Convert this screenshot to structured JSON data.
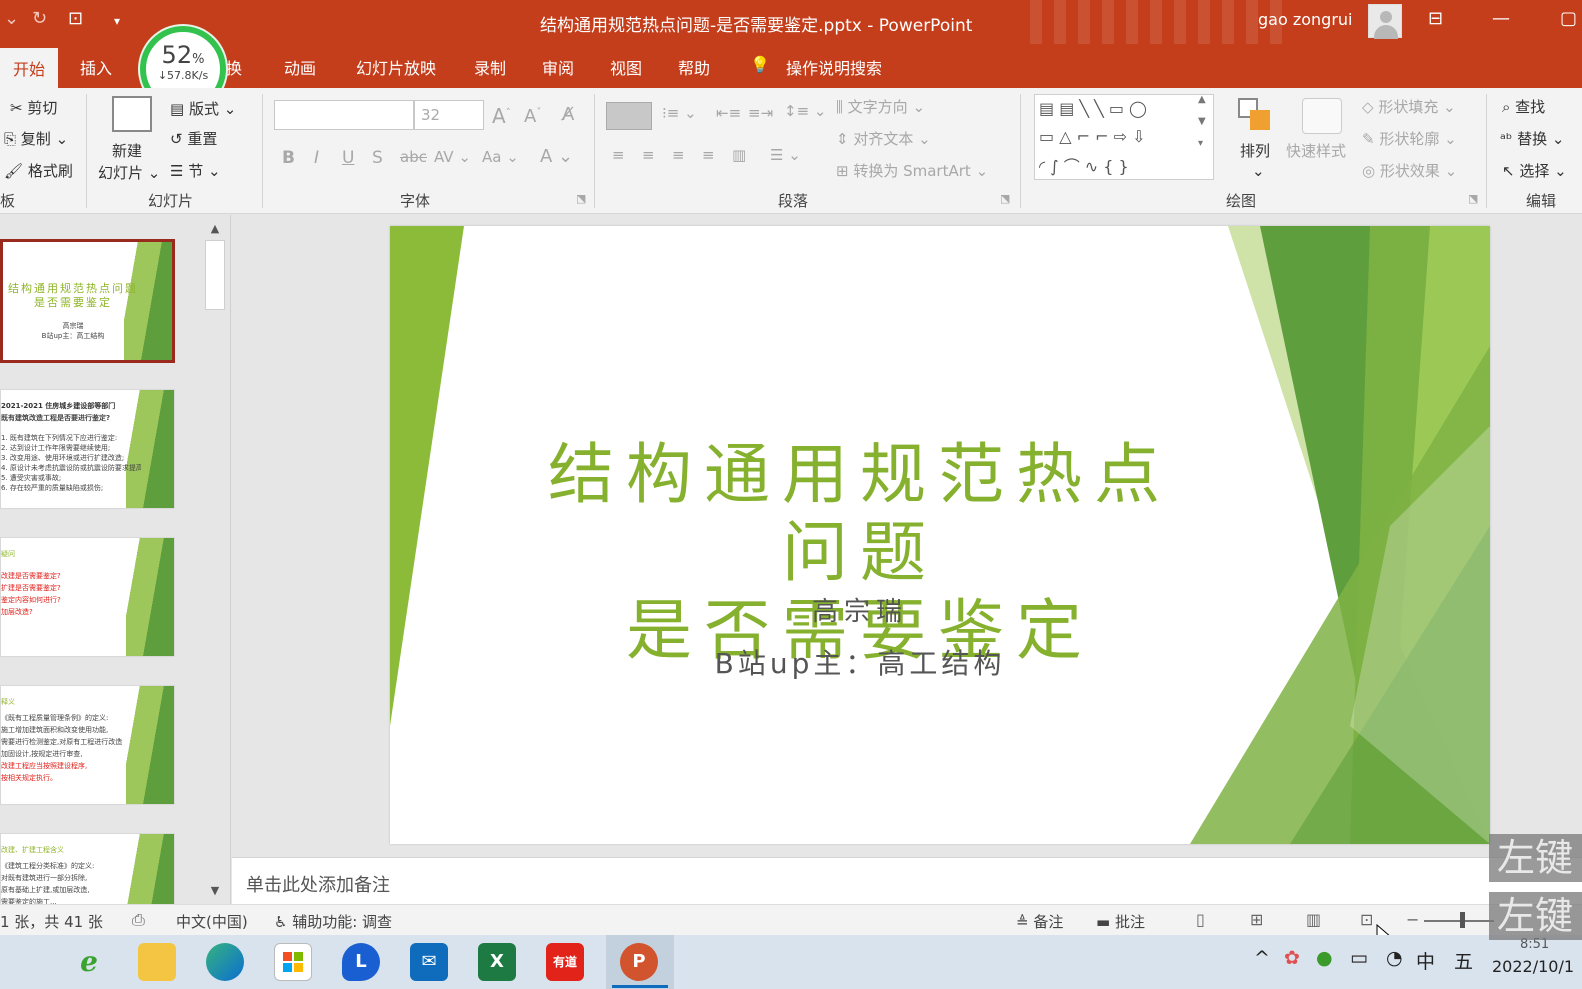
{
  "window": {
    "title": "结构通用规范热点问题-是否需要鉴定.pptx  -  PowerPoint",
    "user": "gao zongrui"
  },
  "speed_widget": {
    "percent": "52",
    "unit": "%",
    "rate": "↓57.8K/s"
  },
  "tabs": [
    "开始",
    "插入",
    "切换",
    "动画",
    "幻灯片放映",
    "录制",
    "审阅",
    "视图",
    "帮助"
  ],
  "tab_partial": "切换",
  "tell_me": "操作说明搜索",
  "ribbon": {
    "clipboard": {
      "cut": "剪切",
      "copy": "复制",
      "format_painter": "格式刷",
      "label": "板"
    },
    "slides": {
      "new_slide_line1": "新建",
      "new_slide_line2": "幻灯片",
      "layout": "版式",
      "reset": "重置",
      "section": "节",
      "label": "幻灯片"
    },
    "font": {
      "size": "32",
      "label": "字体",
      "case": "Aa"
    },
    "paragraph": {
      "text_direction": "文字方向",
      "align_text": "对齐文本",
      "smartart": "转换为 SmartArt",
      "label": "段落"
    },
    "drawing": {
      "arrange": "排列",
      "quick_styles": "快速样式",
      "shape_fill": "形状填充",
      "shape_outline": "形状轮廓",
      "shape_effects": "形状效果",
      "label": "绘图"
    },
    "editing": {
      "find": "查找",
      "replace": "替换",
      "select": "选择",
      "label": "编辑"
    }
  },
  "thumbnails": [
    {
      "title": "结构通用规范热点问题\n是否需要鉴定",
      "lines": [
        "高宗瑞",
        "B站up主：高工结构"
      ]
    },
    {
      "title": "2021-2021 住房城乡建设部等部门",
      "lines": [
        "既有建筑改造工程是否要进行鉴定?",
        "1. 既有建筑在下列情况下应进行鉴定:",
        "2. 达到设计工作年限需要继续使用;",
        "3. 改变用途、使用环境或进行扩建改造;",
        "4. 原设计未考虑抗震设防或抗震设防要求提高;",
        "5. 遭受灾害或事故;",
        "6. 存在较严重的质量缺陷或损伤;"
      ]
    },
    {
      "title": "疑问",
      "lines": [
        "改建是否需要鉴定?",
        "扩建是否需要鉴定?",
        "鉴定内容如何进行?",
        "加层改造?"
      ]
    },
    {
      "title": "释义",
      "lines": [
        "《既有工程质量管理条例》的定义:",
        "施工增加建筑面积和改变使用功能,",
        "需要进行检测鉴定,对原有工程进行改造",
        "加固设计,按规定进行审查,",
        "改建工程应当按照建设程序,",
        "按相关规定执行。"
      ]
    },
    {
      "title": "改建、扩建工程含义",
      "lines": [
        "《建筑工程分类标准》的定义:",
        "对既有建筑进行一部分拆除,",
        "原有基础上扩建,或加层改造,",
        "需要鉴定的施工..."
      ]
    }
  ],
  "slide": {
    "title_line1": "结构通用规范热点问题",
    "title_line2": "是否需要鉴定",
    "author": "高宗瑞",
    "subtitle": "B站up主：高工结构",
    "accent": "#86b12e"
  },
  "notes_placeholder": "单击此处添加备注",
  "status": {
    "slide_count": "1 张，共 41 张",
    "language": "中文(中国)",
    "accessibility": "辅助功能: 调查",
    "notes_btn": "备注",
    "comments_btn": "批注"
  },
  "taskbar": {
    "apps": [
      "ie-icon",
      "file-explorer-icon",
      "edge-icon",
      "store-icon",
      "lenovo-icon",
      "mail-icon",
      "excel-icon",
      "youdao-icon",
      "powerpoint-icon"
    ],
    "youdao_label": "有道",
    "excel_label": "X",
    "ppt_label": "P",
    "lenovo_label": "L",
    "ime": "中",
    "ime2": "五",
    "time": "8:51",
    "date": "2022/10/1"
  },
  "key_hint": "左键"
}
